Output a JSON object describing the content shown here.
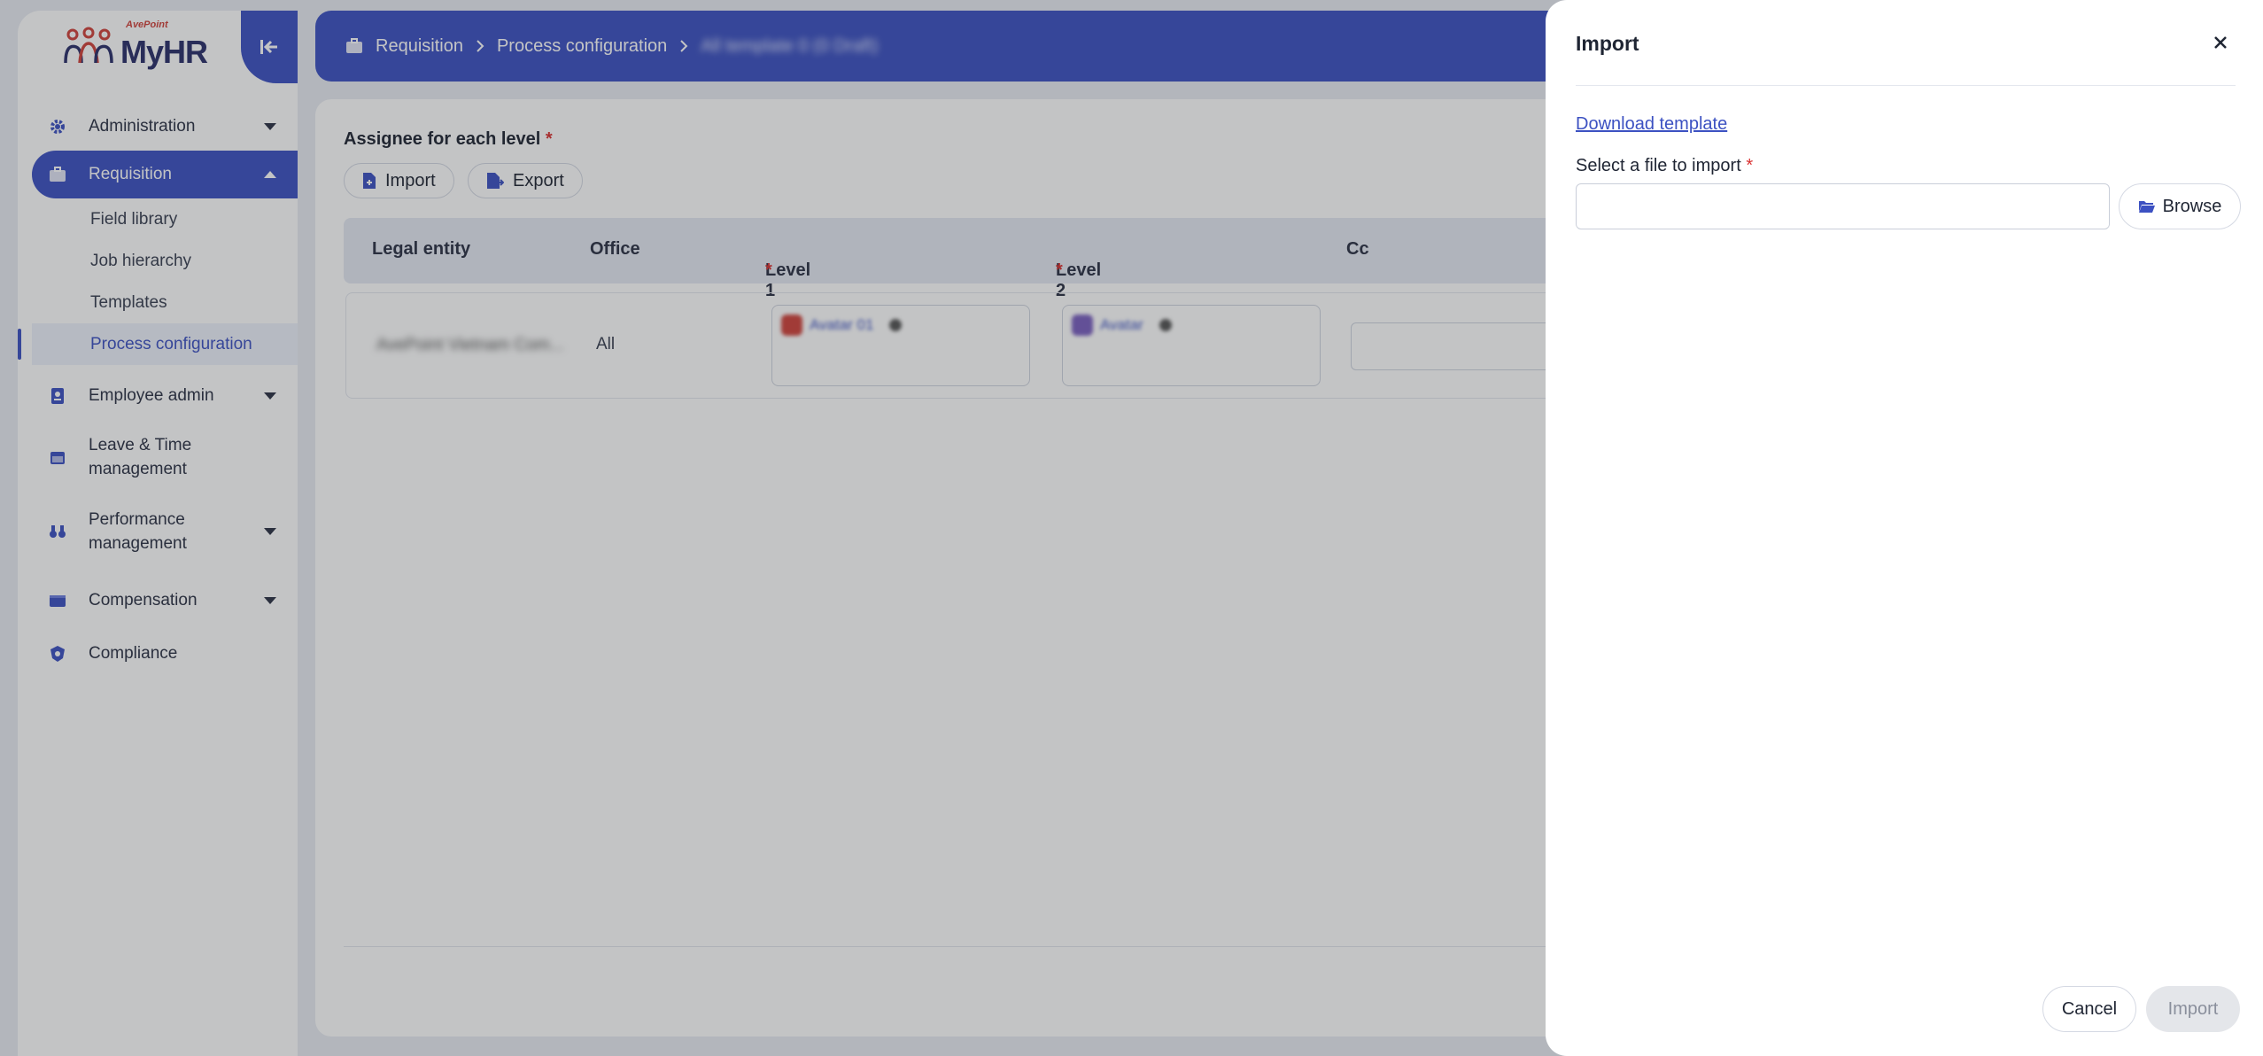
{
  "app": {
    "brand": "AvePoint",
    "name": "MyHR"
  },
  "sidebar": {
    "items": [
      {
        "label": "Administration",
        "icon": "gear-icon"
      },
      {
        "label": "Requisition",
        "icon": "briefcase-icon"
      },
      {
        "label": "Employee admin",
        "icon": "badge-icon"
      },
      {
        "label": "Leave & Time management",
        "icon": "calendar-icon"
      },
      {
        "label": "Performance management",
        "icon": "binoculars-icon"
      },
      {
        "label": "Compensation",
        "icon": "wallet-icon"
      },
      {
        "label": "Compliance",
        "icon": "shield-gear-icon"
      }
    ],
    "requisition_subitems": [
      "Field library",
      "Job hierarchy",
      "Templates",
      "Process configuration"
    ]
  },
  "breadcrumb": {
    "root": "Requisition",
    "section": "Process configuration",
    "current": "All template 0 (0 Draft)"
  },
  "main": {
    "section_title": "Assignee for each level",
    "required_mark": "*",
    "import_label": "Import",
    "export_label": "Export",
    "table": {
      "headers": [
        "Legal entity",
        "Office",
        "Level 1",
        "Level 2",
        "Cc"
      ],
      "row": {
        "legal_entity": "AvePoint Vietnam Com...",
        "office": "All",
        "level1_assignee": "Avatar 01",
        "level2_assignee": "Avatar"
      }
    }
  },
  "drawer": {
    "title": "Import",
    "download_template": "Download template",
    "file_label": "Select a file to import",
    "required_mark": "*",
    "file_value": "",
    "browse_label": "Browse",
    "cancel_label": "Cancel",
    "import_label": "Import"
  },
  "colors": {
    "primary": "#3c51c2",
    "required": "#d93030",
    "overlay": "rgba(40,42,48,0.28)"
  }
}
